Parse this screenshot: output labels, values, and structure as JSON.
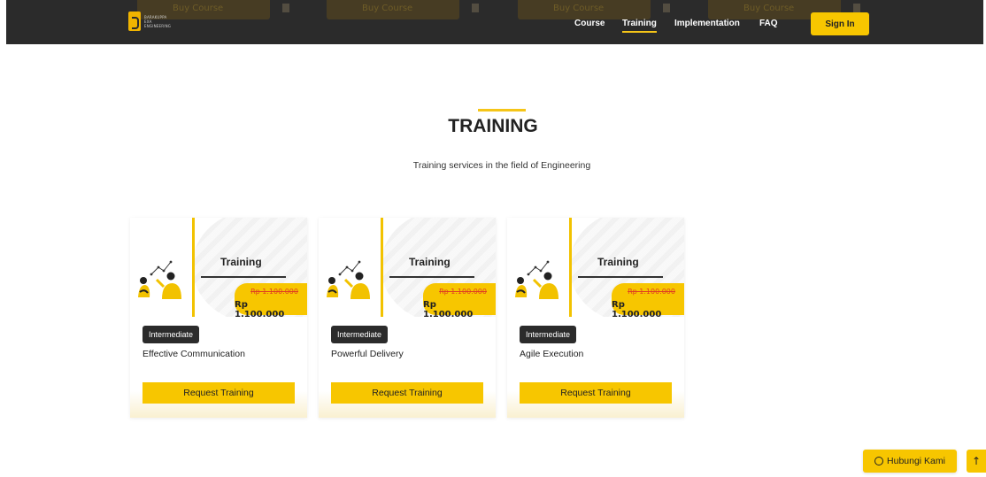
{
  "header": {
    "logo_text": [
      "BARAKUPPA",
      "EXA",
      "ENGINEERING"
    ],
    "ghost_buttons": [
      "Buy Course",
      "Buy Course",
      "Buy Course",
      "Buy Course"
    ],
    "nav": [
      {
        "label": "Course"
      },
      {
        "label": "Training",
        "active": true
      },
      {
        "label": "Implementation"
      },
      {
        "label": "FAQ"
      }
    ],
    "signin_label": "Sign In"
  },
  "section": {
    "title": "TRAINING",
    "subtitle": "Training services in the field of Engineering"
  },
  "cards": [
    {
      "thumb_label": "Training",
      "price_old": "Rp 1.100.000",
      "price_new": "Rp 1.100.000",
      "level": "Intermediate",
      "name": "Effective Communication",
      "button": "Request Training"
    },
    {
      "thumb_label": "Training",
      "price_old": "Rp 1.100.000",
      "price_new": "Rp 1.100.000",
      "level": "Intermediate",
      "name": "Powerful Delivery",
      "button": "Request Training"
    },
    {
      "thumb_label": "Training",
      "price_old": "Rp 1.100.000",
      "price_new": "Rp 1.100.000",
      "level": "Intermediate",
      "name": "Agile Execution",
      "button": "Request Training"
    }
  ],
  "floating": {
    "whatsapp_label": "Hubungi Kami",
    "whatsapp_icon": "whatsapp-icon",
    "up_icon": "arrow-up-icon",
    "up_glyph": "↑"
  },
  "colors": {
    "accent": "#f7c600",
    "header_bg": "#2b2b2b",
    "strike_price": "#e04020"
  }
}
